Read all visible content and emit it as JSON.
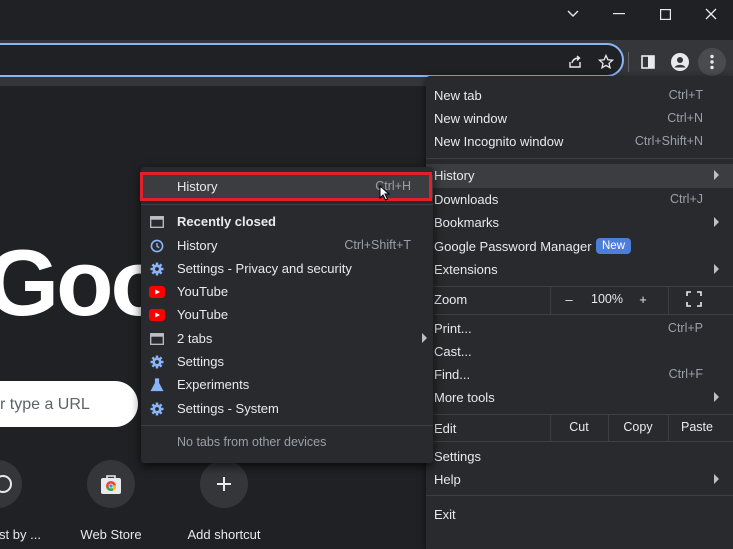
{
  "colors": {
    "accent": "#8ab4f8",
    "highlight_box": "#e0202b",
    "new_badge": "#4d7fd8"
  },
  "titlebar": {
    "icons": [
      "chevron-down-icon",
      "minimize-icon",
      "maximize-icon",
      "close-icon"
    ]
  },
  "toolbar": {
    "icons": [
      "share-icon",
      "star-icon",
      "side-panel-icon",
      "profile-icon",
      "more-vert-icon"
    ]
  },
  "ntp": {
    "logo_text": "Goo",
    "search_placeholder": "r type a URL",
    "shortcuts": [
      {
        "label": "st by ...",
        "icon": "shortcut-icon"
      },
      {
        "label": "Web Store",
        "icon": "web-store-icon"
      },
      {
        "label": "Add shortcut",
        "icon": "plus-icon"
      }
    ]
  },
  "main_menu": {
    "new_tab": {
      "label": "New tab",
      "shortcut": "Ctrl+T"
    },
    "new_window": {
      "label": "New window",
      "shortcut": "Ctrl+N"
    },
    "new_incognito": {
      "label": "New Incognito window",
      "shortcut": "Ctrl+Shift+N"
    },
    "history": {
      "label": "History"
    },
    "downloads": {
      "label": "Downloads",
      "shortcut": "Ctrl+J"
    },
    "bookmarks": {
      "label": "Bookmarks"
    },
    "password_manager": {
      "label": "Google Password Manager",
      "badge": "New"
    },
    "extensions": {
      "label": "Extensions"
    },
    "zoom": {
      "label": "Zoom",
      "minus": "–",
      "value": "100%",
      "plus": "+"
    },
    "print": {
      "label": "Print...",
      "shortcut": "Ctrl+P"
    },
    "cast": {
      "label": "Cast..."
    },
    "find": {
      "label": "Find...",
      "shortcut": "Ctrl+F"
    },
    "more_tools": {
      "label": "More tools"
    },
    "edit": {
      "label": "Edit",
      "cut": "Cut",
      "copy": "Copy",
      "paste": "Paste"
    },
    "settings": {
      "label": "Settings"
    },
    "help": {
      "label": "Help"
    },
    "exit": {
      "label": "Exit"
    }
  },
  "history_menu": {
    "history": {
      "label": "History",
      "shortcut": "Ctrl+H"
    },
    "recently_closed": "Recently closed",
    "items": [
      {
        "label": "History",
        "shortcut": "Ctrl+Shift+T",
        "icon": "history-icon"
      },
      {
        "label": "Settings - Privacy and security",
        "icon": "settings-gear-icon"
      },
      {
        "label": "YouTube",
        "icon": "youtube-icon"
      },
      {
        "label": "YouTube",
        "icon": "youtube-icon"
      },
      {
        "label": "2 tabs",
        "icon": "window-icon"
      },
      {
        "label": "Settings",
        "icon": "settings-gear-icon"
      },
      {
        "label": "Experiments",
        "icon": "flask-icon"
      },
      {
        "label": "Settings - System",
        "icon": "settings-gear-icon"
      }
    ],
    "no_tabs": "No tabs from other devices"
  }
}
